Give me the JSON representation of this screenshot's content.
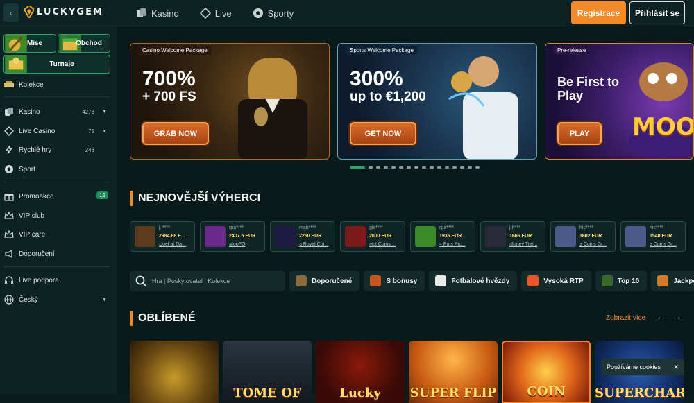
{
  "brand": {
    "name": "LUCKYGEM"
  },
  "nav": [
    {
      "label": "Kasino",
      "icon": "casino-icon"
    },
    {
      "label": "Live",
      "icon": "live-icon"
    },
    {
      "label": "Sporty",
      "icon": "sports-ball-icon"
    }
  ],
  "auth": {
    "register": "Registrace",
    "login": "Přihlásit se"
  },
  "sidebar": {
    "quick": {
      "missions": "Mise",
      "shop": "Obchod",
      "tournaments": "Turnaje"
    },
    "collections": "Kolekce",
    "items": [
      {
        "label": "Kasino",
        "count": "4273"
      },
      {
        "label": "Live Casino",
        "count": "75"
      },
      {
        "label": "Rychlé hry",
        "count": "248"
      },
      {
        "label": "Sport"
      }
    ],
    "promo": {
      "label": "Promoakce",
      "badge": "19"
    },
    "vip_club": "VIP club",
    "vip_care": "VIP care",
    "referral": "Doporučení",
    "support": "Live podpora",
    "language": "Český"
  },
  "banners": [
    {
      "tag": "Casino Welcome Package",
      "big": "700%",
      "sub": "+ 700 FS",
      "button": "GRAB NOW"
    },
    {
      "tag": "Sports Welcome Package",
      "big": "300%",
      "sub": "up to €1,200",
      "button": "GET NOW"
    },
    {
      "tag": "Pre-release",
      "big": "Be First to Play",
      "button": "PLAY",
      "art": "MOO"
    }
  ],
  "carousel": {
    "total": 16,
    "active": 0
  },
  "winners_title": "NEJNOVĚJŠÍ VÝHERCI",
  "winners": [
    {
      "user": "j.l****",
      "amount": "2984.88 E...",
      "game": "Duel at Da..."
    },
    {
      "user": "rpa****",
      "amount": "2407.5 EUR",
      "game": "MooFO"
    },
    {
      "user": "man****",
      "amount": "2250 EUR",
      "game": "3 Royal Coi..."
    },
    {
      "user": "gis****",
      "amount": "2000 EUR",
      "game": "Hot Coins ..."
    },
    {
      "user": "rpa****",
      "amount": "1935 EUR",
      "game": "4 Pots Ric..."
    },
    {
      "user": "j.l****",
      "amount": "1666 EUR",
      "game": "Money Trai..."
    },
    {
      "user": "hic****",
      "amount": "1602 EUR",
      "game": "9 Coins Gr..."
    },
    {
      "user": "hic****",
      "amount": "1540 EUR",
      "game": "9 Coins Gr..."
    }
  ],
  "search": {
    "placeholder": "Hra | Poskytovatel | Kolekce"
  },
  "chips": [
    {
      "label": "Doporučené",
      "icon": "recommended-icon"
    },
    {
      "label": "S bonusy",
      "icon": "bonus-icon"
    },
    {
      "label": "Fotbalové hvězdy",
      "icon": "football-icon"
    },
    {
      "label": "Vysoká RTP",
      "icon": "fire-icon"
    },
    {
      "label": "Top 10",
      "icon": "top10-icon"
    },
    {
      "label": "Jackpo",
      "icon": "jackpot-icon"
    }
  ],
  "favorites": {
    "title": "OBLÍBENÉ",
    "see_more": "Zobrazit více"
  },
  "games": [
    {
      "label": ""
    },
    {
      "label": "TOME OF"
    },
    {
      "label": "Lucky"
    },
    {
      "label": "SUPER FLIP"
    },
    {
      "label": "COIN"
    },
    {
      "label": "SUPERCHARGED"
    }
  ],
  "cookie": {
    "text": "Používáme cookies"
  },
  "colors": {
    "accent": "#f28a2a",
    "green": "#2ea56b",
    "bg": "#091a1b"
  }
}
